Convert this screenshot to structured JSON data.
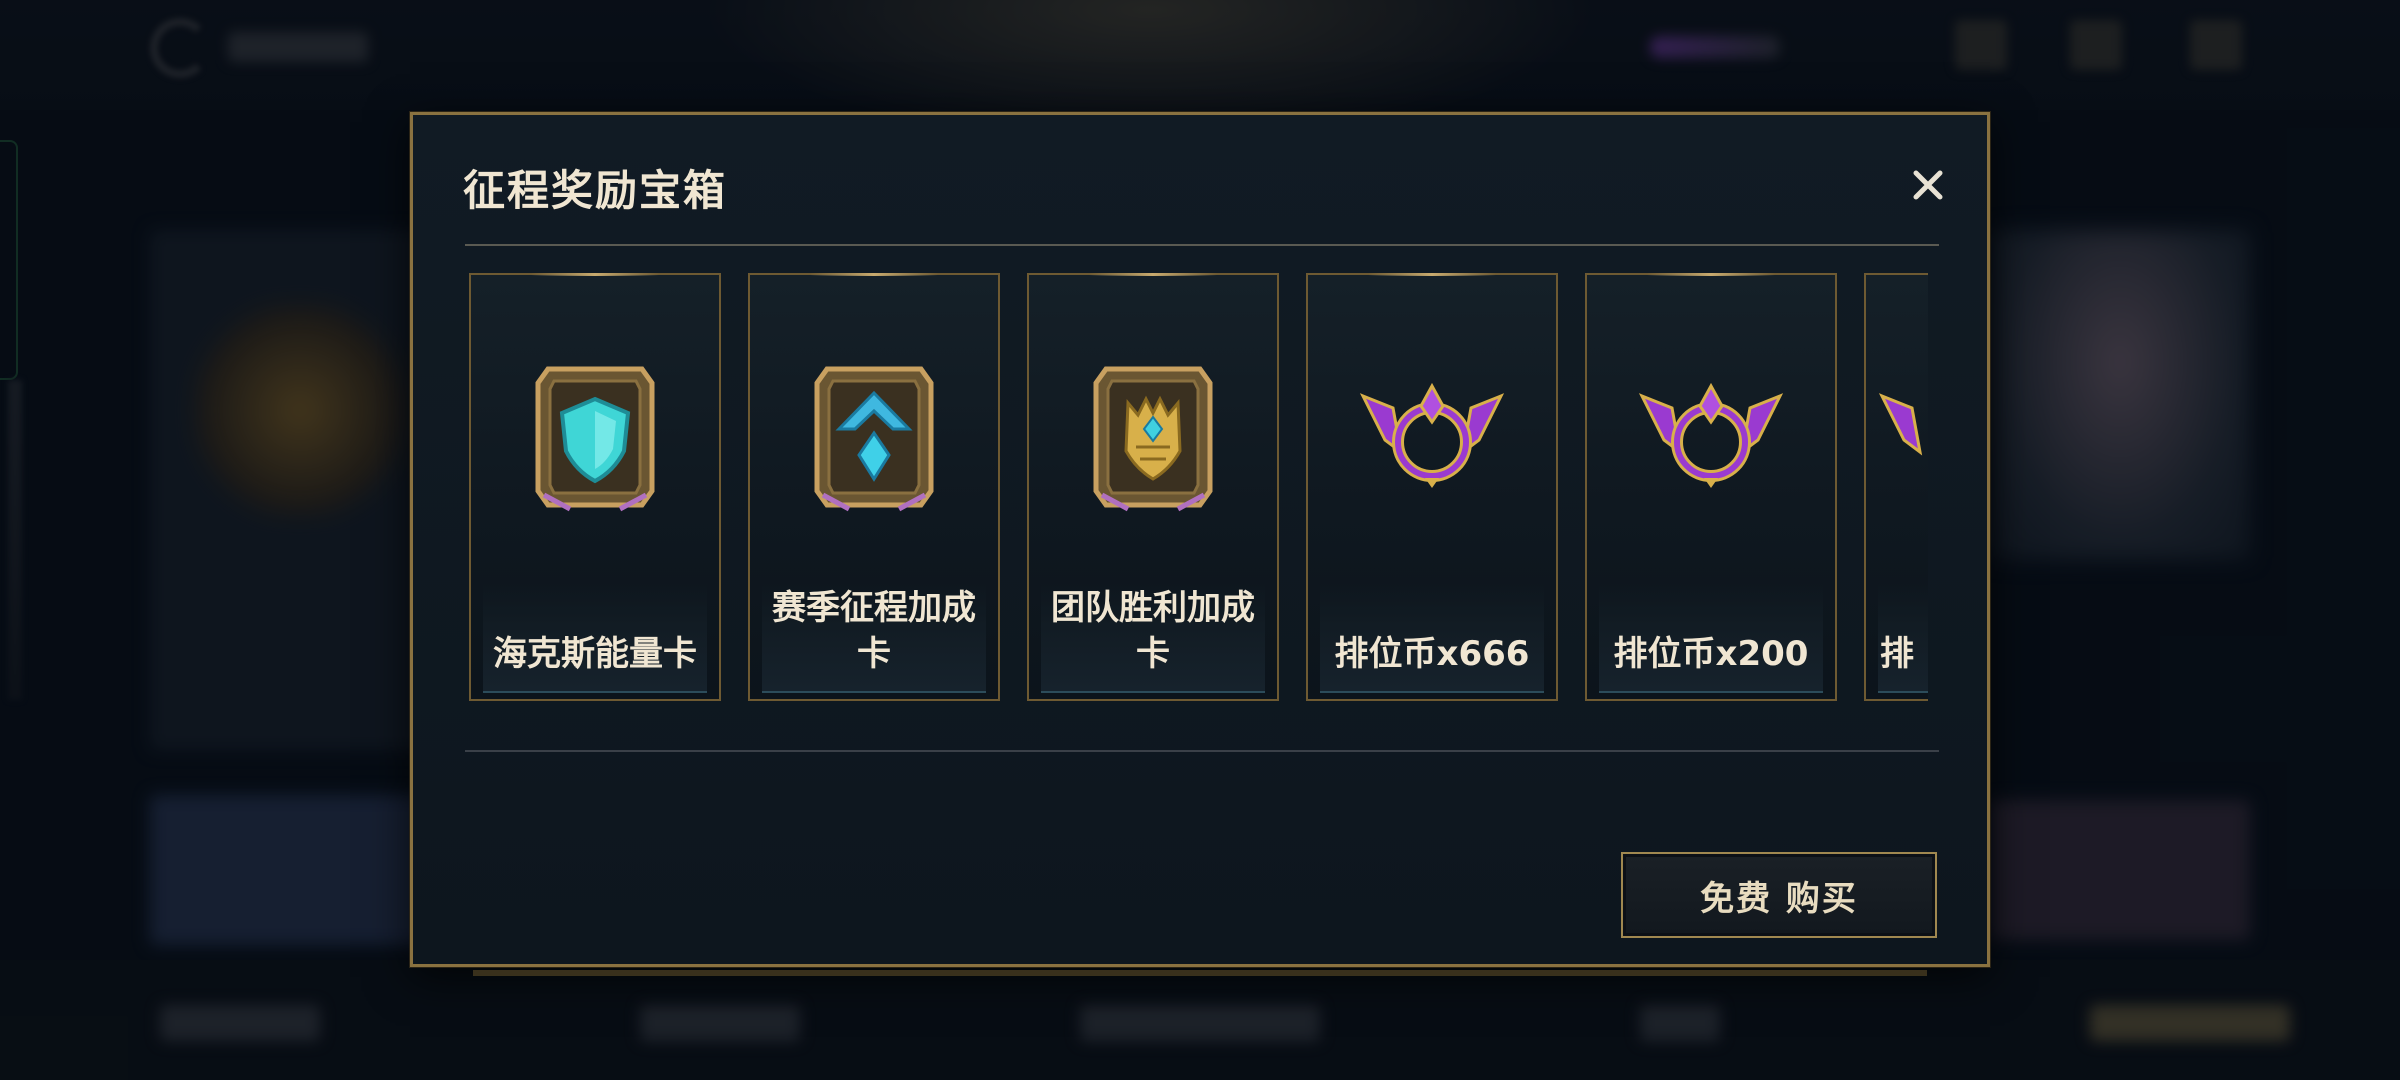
{
  "dialog": {
    "title": "征程奖励宝箱",
    "close_icon": "close-icon",
    "buy_button_label": "免费 购买",
    "items": [
      {
        "label": "海克斯能量卡",
        "icon": "hextech-shield-card-icon",
        "accent": "#3fd6d6"
      },
      {
        "label": "赛季征程加成卡",
        "icon": "season-journey-boost-card-icon",
        "accent": "#3fb8e0"
      },
      {
        "label": "团队胜利加成卡",
        "icon": "team-victory-boost-card-icon",
        "accent": "#d8b04a"
      },
      {
        "label": "排位币x666",
        "icon": "ranked-coin-icon",
        "accent": "#9a3ad0"
      },
      {
        "label": "排位币x200",
        "icon": "ranked-coin-icon",
        "accent": "#9a3ad0"
      },
      {
        "label": "排",
        "icon": "ranked-coin-icon",
        "accent": "#9a3ad0"
      }
    ]
  },
  "colors": {
    "gold_border": "#8a7240",
    "panel_bg": "#111b24",
    "text": "#f0e6d2"
  }
}
